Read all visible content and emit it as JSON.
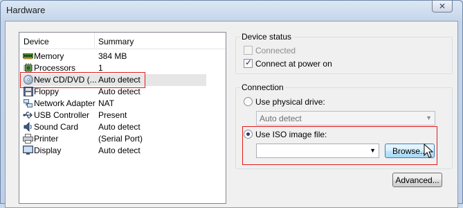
{
  "window": {
    "title": "Hardware",
    "close_glyph": "✕"
  },
  "list": {
    "headers": {
      "device": "Device",
      "summary": "Summary"
    },
    "rows": [
      {
        "device": "Memory",
        "summary": "384 MB",
        "icon": "memory-icon"
      },
      {
        "device": "Processors",
        "summary": "1",
        "icon": "processor-icon"
      },
      {
        "device": "New CD/DVD (...",
        "summary": "Auto detect",
        "icon": "cd-dvd-icon",
        "selected": true
      },
      {
        "device": "Floppy",
        "summary": "Auto detect",
        "icon": "floppy-icon"
      },
      {
        "device": "Network Adapter",
        "summary": "NAT",
        "icon": "network-adapter-icon"
      },
      {
        "device": "USB Controller",
        "summary": "Present",
        "icon": "usb-icon"
      },
      {
        "device": "Sound Card",
        "summary": "Auto detect",
        "icon": "sound-card-icon"
      },
      {
        "device": "Printer",
        "summary": "(Serial Port)",
        "icon": "printer-icon"
      },
      {
        "device": "Display",
        "summary": "Auto detect",
        "icon": "display-icon"
      }
    ]
  },
  "device_status": {
    "label": "Device status",
    "connected": {
      "label": "Connected",
      "checked": false,
      "disabled": true
    },
    "connect_at_power_on": {
      "label": "Connect at power on",
      "checked": true
    }
  },
  "connection": {
    "label": "Connection",
    "physical_drive": {
      "label": "Use physical drive:",
      "selected": false,
      "value": "Auto detect"
    },
    "iso_image": {
      "label": "Use ISO image file:",
      "selected": true,
      "value": ""
    },
    "browse_label": "Browse...",
    "advanced_label": "Advanced..."
  },
  "colors": {
    "highlight_box": "#e01a1a",
    "selected_row": "#e6e6e6"
  }
}
